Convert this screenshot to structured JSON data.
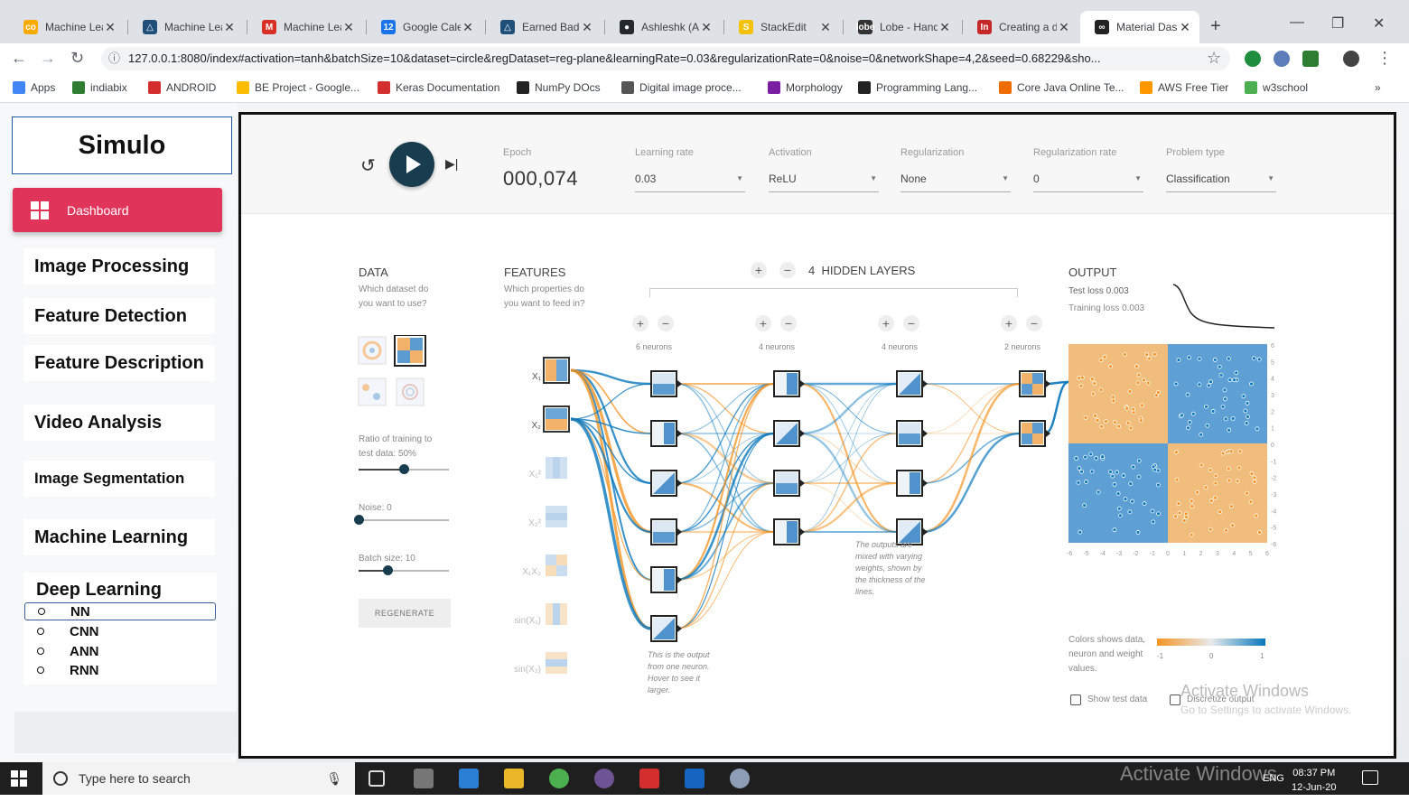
{
  "browser": {
    "tabs": [
      {
        "label": "Machine Lea",
        "fav": "co",
        "color": "#f9ab00"
      },
      {
        "label": "Machine Lea",
        "fav": "△",
        "color": "#1f4e79"
      },
      {
        "label": "Machine Lea",
        "fav": "M",
        "color": "#d93025"
      },
      {
        "label": "Google Cale",
        "fav": "12",
        "color": "#1a73e8"
      },
      {
        "label": "Earned Badg",
        "fav": "△",
        "color": "#1f4e79"
      },
      {
        "label": "Ashleshk (A",
        "fav": "●",
        "color": "#24292e"
      },
      {
        "label": "StackEdit",
        "fav": "S",
        "color": "#f4c20d"
      },
      {
        "label": "Lobe - Hand",
        "fav": "lobe",
        "color": "#333333"
      },
      {
        "label": "Creating a d",
        "fav": "In",
        "color": "#c62828"
      },
      {
        "label": "Material Das",
        "fav": "∞",
        "color": "#222222"
      }
    ],
    "url": "127.0.0.1:8080/index#activation=tanh&batchSize=10&dataset=circle&regDataset=reg-plane&learningRate=0.03&regularizationRate=0&noise=0&networkShape=4,2&seed=0.68229&sho...",
    "bookmarks": [
      "Apps",
      "indiabix",
      "ANDROID",
      "BE Project - Google...",
      "Keras Documentation",
      "NumPy DOcs",
      "Digital image proce...",
      "Morphology",
      "Programming Lang...",
      "Core Java Online Te...",
      "AWS Free Tier",
      "w3school"
    ],
    "more": "»"
  },
  "sidebar": {
    "brand": "Simulo",
    "dashboard": "Dashboard",
    "items": [
      "Image Processing",
      "Feature Detection",
      "Feature Description",
      "Video Analysis",
      "Image Segmentation",
      "Machine Learning"
    ],
    "deep_learning": {
      "title": "Deep Learning",
      "subs": [
        "NN",
        "CNN",
        "ANN",
        "RNN"
      ]
    }
  },
  "playground": {
    "epoch_label": "Epoch",
    "epoch": "000,074",
    "controls": [
      {
        "label": "Learning rate",
        "value": "0.03"
      },
      {
        "label": "Activation",
        "value": "ReLU"
      },
      {
        "label": "Regularization",
        "value": "None"
      },
      {
        "label": "Regularization rate",
        "value": "0"
      },
      {
        "label": "Problem type",
        "value": "Classification"
      }
    ],
    "data": {
      "title": "DATA",
      "question": "Which dataset do you want to use?",
      "ratio_label": "Ratio of training to test data:",
      "ratio_value": "50%",
      "ratio": 0.5,
      "noise_label": "Noise:",
      "noise_value": "0",
      "noise": 0,
      "batch_label": "Batch size:",
      "batch_value": "10",
      "batch": 0.32,
      "regenerate": "REGENERATE"
    },
    "features": {
      "title": "FEATURES",
      "question": "Which properties do you want to feed in?",
      "names": [
        "X₁",
        "X₂",
        "X₁²",
        "X₂²",
        "X₁X₂",
        "sin(X₁)",
        "sin(X₂)"
      ]
    },
    "hidden": {
      "count": "4",
      "title": "HIDDEN LAYERS",
      "layers": [
        "6 neurons",
        "4 neurons",
        "4 neurons",
        "2 neurons"
      ],
      "note1": "This is the output from one neuron. Hover to see it larger.",
      "note2": "The outputs are mixed with varying weights, shown by the thickness of the lines."
    },
    "output": {
      "title": "OUTPUT",
      "test_loss": "Test loss 0.003",
      "training_loss": "Training loss 0.003",
      "y_ticks": [
        "6",
        "5",
        "4",
        "3",
        "2",
        "1",
        "0",
        "-1",
        "-2",
        "-3",
        "-4",
        "-5",
        "-6"
      ],
      "x_ticks": [
        "-6",
        "-5",
        "-4",
        "-3",
        "-2",
        "-1",
        "0",
        "1",
        "2",
        "3",
        "4",
        "5",
        "6"
      ],
      "legend_text": "Colors shows data, neuron and weight values.",
      "legend_ticks": [
        "-1",
        "0",
        "1"
      ],
      "show_test": "Show test data",
      "discretize": "Discretize output"
    },
    "watermark": "Activate Windows",
    "watermark_sub": "Go to Settings to activate Windows."
  },
  "taskbar": {
    "search": "Type here to search",
    "time": "08:37 PM",
    "date": "12-Jun-20",
    "lang": "ENG",
    "watermark": "Activate Windows"
  },
  "colors": {
    "orange": "#f59322",
    "blue": "#0877bd",
    "accent": "#e0345b",
    "dark": "#183d4e"
  }
}
